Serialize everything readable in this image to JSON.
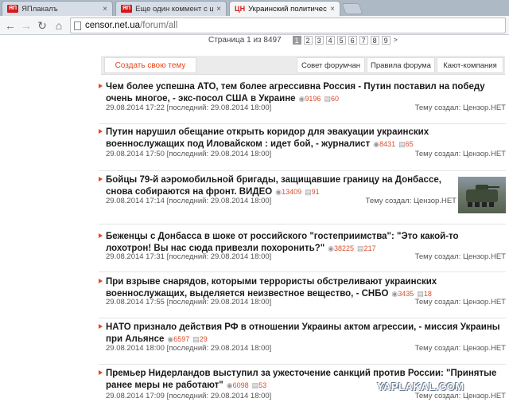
{
  "browser": {
    "tabs": [
      {
        "favicon": "ЯП",
        "label": "ЯПлакалъ"
      },
      {
        "favicon": "ЯП",
        "label": "Еще один коммент с цен"
      },
      {
        "favicon": "ЦН",
        "label": "Украинский политическ"
      }
    ],
    "tab_close": "×",
    "address": {
      "host": "censor.net.ua",
      "path": "/forum/all"
    }
  },
  "pager": {
    "label": "Страница 1 из 8497",
    "pages": [
      "1",
      "2",
      "3",
      "4",
      "5",
      "6",
      "7",
      "8",
      "9"
    ],
    "next": ">"
  },
  "actions": {
    "create_topic": "Создать свою тему",
    "buttons": [
      "Совет форумчан",
      "Правила форума",
      "Кают-компания"
    ]
  },
  "topics": [
    {
      "title": "Чем более успешна АТО, тем более агрессивна Россия - Путин поставил на победу очень многое, - экс-посол США в Украине",
      "views": "9196",
      "comments": "60",
      "created": "29.08.2014 17:22",
      "last": "[последний: 29.08.2014 18:00]",
      "creator": "Тему создал: Цензор.НЕТ"
    },
    {
      "title": "Путин нарушил обещание открыть коридор для эвакуации украинских военнослужащих под Иловайском : идет бой, - журналист",
      "views": "8431",
      "comments": "65",
      "created": "29.08.2014 17:50",
      "last": "[последний: 29.08.2014 18:00]",
      "creator": "Тему создал: Цензор.НЕТ"
    },
    {
      "title": "Бойцы 79-й аэромобильной бригады, защищавшие границу на Донбассе, снова собираются на фронт. ВИДЕО",
      "views": "13409",
      "comments": "91",
      "created": "29.08.2014 17:14",
      "last": "[последний: 29.08.2014 18:00]",
      "creator": "Тему создал: Цензор.НЕТ"
    },
    {
      "title": "Беженцы с Донбасса в шоке от российского \"гостеприимства\": \"Это какой-то лохотрон! Вы нас сюда привезли похоронить?\"",
      "views": "38225",
      "comments": "217",
      "created": "29.08.2014 17:31",
      "last": "[последний: 29.08.2014 18:00]",
      "creator": "Тему создал: Цензор.НЕТ"
    },
    {
      "title": "При взрыве снарядов, которыми террористы обстреливают украинских военнослужащих, выделяется неизвестное вещество, - СНБО",
      "views": "3435",
      "comments": "18",
      "created": "29.08.2014 17:55",
      "last": "[последний: 29.08.2014 18:00]",
      "creator": "Тему создал: Цензор.НЕТ"
    },
    {
      "title": "НАТО признало действия РФ в отношении Украины актом агрессии, - миссия Украины при Альянсе",
      "views": "6597",
      "comments": "29",
      "created": "29.08.2014 18:00",
      "last": "[последний: 29.08.2014 18:00]",
      "creator": "Тему создал: Цензор.НЕТ"
    },
    {
      "title": "Премьер Нидерландов выступил за ужесточение санкций против России: \"Принятые ранее меры не работают\"",
      "views": "6098",
      "comments": "53",
      "created": "29.08.2014 17:09",
      "last": "[последний: 29.08.2014 18:00]",
      "creator": "Тему создал: Цензор.НЕТ"
    }
  ],
  "watermark": "YAPLAKAL.COM",
  "colors": {
    "accent": "#e8461a",
    "stats": "#d94d2b"
  }
}
